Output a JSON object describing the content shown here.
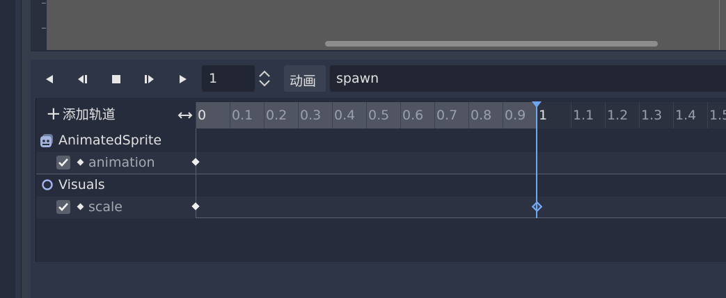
{
  "viewport": {},
  "transport": {
    "play_backward_icon": "play-backward-icon",
    "step_back_icon": "step-back-icon",
    "stop_icon": "stop-icon",
    "step_forward_icon": "step-forward-icon",
    "play_icon": "play-icon",
    "frame_value": "1"
  },
  "animation": {
    "label": "动画",
    "name": "spawn"
  },
  "timeline": {
    "add_track_label": "添加轨道",
    "ruler": [
      "0",
      "0.1",
      "0.2",
      "0.3",
      "0.4",
      "0.5",
      "0.6",
      "0.7",
      "0.8",
      "0.9",
      "1",
      "1.1",
      "1.2",
      "1.3",
      "1.4",
      "1.5"
    ],
    "current_time": 1,
    "groups": [
      {
        "name": "AnimatedSprite",
        "icon": "animated-sprite-icon",
        "tracks": [
          {
            "name": "animation",
            "enabled": true,
            "keyframes": [
              0
            ]
          }
        ]
      },
      {
        "name": "Visuals",
        "icon": "node2d-circle-icon",
        "tracks": [
          {
            "name": "scale",
            "enabled": true,
            "keyframes": [
              0,
              1
            ]
          }
        ]
      }
    ]
  },
  "colors": {
    "accent": "#6ea6f0",
    "panel": "#2e3546",
    "track_bg": "#262c3b"
  }
}
